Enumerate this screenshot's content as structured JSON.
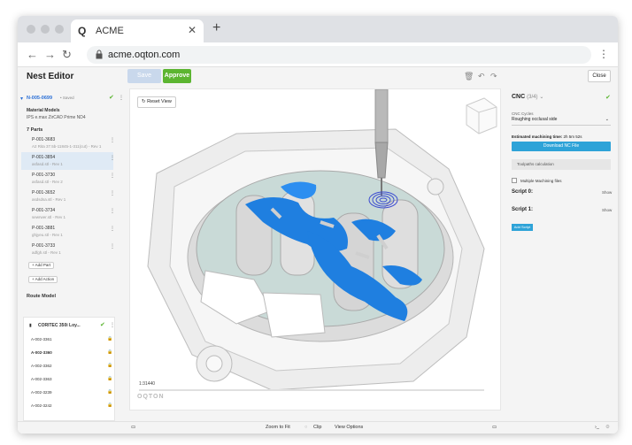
{
  "browser": {
    "tab_title": "ACME",
    "tab_logo": "Q",
    "url": "acme.oqton.com"
  },
  "toolbar": {
    "page_title": "Nest Editor",
    "disabled_btn_label": "Save",
    "approve_label": "Approve",
    "close_label": "Close"
  },
  "left_panel": {
    "nest_id": "N-005-0699",
    "nest_status": "• Saved",
    "material_heading": "Material Models",
    "material_value": "IPS e.max ZirCAD Prime ND4",
    "parts_heading": "7 Parts",
    "parts": [
      {
        "id": "P-001-3683",
        "file": "A2 Rita 37.5b-11845-1-311(cut) - Rev 1"
      },
      {
        "id": "P-001-3854",
        "file": "asfasd.stl - Rev 1"
      },
      {
        "id": "P-001-3730",
        "file": "asfasd.stl - Rev 2"
      },
      {
        "id": "P-001-3652",
        "file": "asdsdsa.stl - Rev 1"
      },
      {
        "id": "P-001-3734",
        "file": "sewrwer.stl - Rev 1"
      },
      {
        "id": "P-001-3881",
        "file": "ghjyeu.stl - Rev 1"
      },
      {
        "id": "P-001-3733",
        "file": "adfgh.stl - Rev 1"
      }
    ],
    "add_part": "+ Add Part",
    "add_action": "+ Add Action",
    "route_heading": "Route Model",
    "route_name": "CORITEC 350i Loy...",
    "route_items": [
      "A-002-3361",
      "A-002-3360",
      "A-002-3362",
      "A-002-3363",
      "A-002-3239",
      "A-002-3242"
    ]
  },
  "viewport": {
    "reset_label": "Reset View",
    "scale": "1:31440",
    "logo": "OQTON"
  },
  "right_panel": {
    "cnc_title": "CNC",
    "cnc_count": "(3/4)",
    "cycles_label": "CNC Cycles",
    "cycles_value": "Roughing occlusal side",
    "machining_label": "Estimated machining time:",
    "machining_value": "2h 5m 52s",
    "download_label": "Download NC File",
    "toolpaths_label": "Toolpaths calculation",
    "multi_label": "Multiple Machining files",
    "script0": "Script 0:",
    "script1": "Script 1:",
    "show": "Show",
    "add_script": "Add Script"
  },
  "bottom_bar": {
    "zoom_fit": "Zoom to Fit",
    "clip": "Clip",
    "view_options": "View Options"
  },
  "colors": {
    "approve": "#5cb531",
    "accent_blue": "#2ea3d8",
    "part_blue": "#1f7fe0"
  }
}
